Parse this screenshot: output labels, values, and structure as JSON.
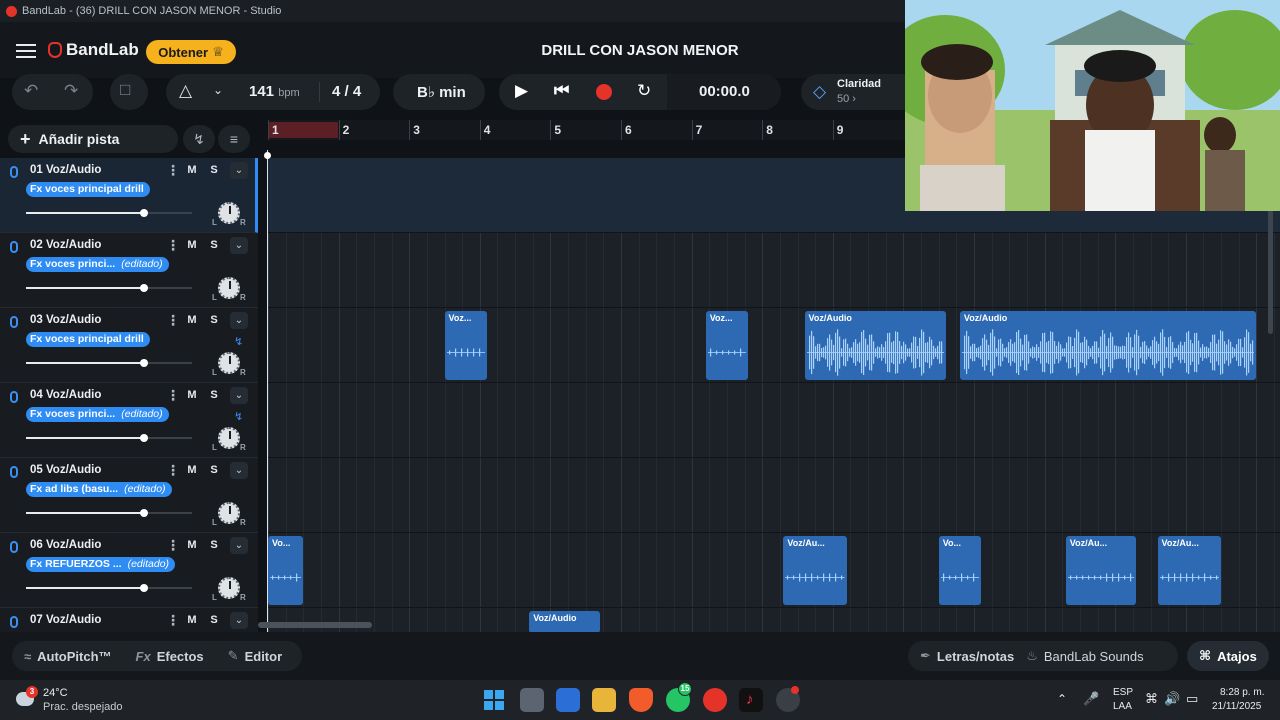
{
  "window": {
    "title": "BandLab - (36) DRILL CON JASON MENOR - Studio"
  },
  "header": {
    "brand": "BandLab",
    "get_button": "Obtener",
    "song_title": "DRILL CON JASON MENOR"
  },
  "toolbar": {
    "tempo_value": "141",
    "tempo_unit": "bpm",
    "time_signature": "4 / 4",
    "key": "B♭ min",
    "time_display": "00:00.0",
    "clarity_label": "Claridad",
    "clarity_value": "50"
  },
  "tracks_panel": {
    "add_track_label": "Añadir pista",
    "mute_label": "M",
    "solo_label": "S",
    "pan_left": "L",
    "pan_right": "R",
    "tracks": [
      {
        "name": "01  Voz/Audio",
        "fx": "Fx voces principal drill",
        "edited": "",
        "volume": 0.71,
        "selected": true,
        "automation": false
      },
      {
        "name": "02  Voz/Audio",
        "fx": "Fx voces princi...",
        "edited": "(editado)",
        "volume": 0.71,
        "selected": false,
        "automation": false
      },
      {
        "name": "03  Voz/Audio",
        "fx": "Fx voces principal drill",
        "edited": "",
        "volume": 0.71,
        "selected": false,
        "automation": true
      },
      {
        "name": "04  Voz/Audio",
        "fx": "Fx voces princi...",
        "edited": "(editado)",
        "volume": 0.71,
        "selected": false,
        "automation": true
      },
      {
        "name": "05  Voz/Audio",
        "fx": "Fx ad libs (basu...",
        "edited": "(editado)",
        "volume": 0.71,
        "selected": false,
        "automation": false
      },
      {
        "name": "06  Voz/Audio",
        "fx": "Fx REFUERZOS ...",
        "edited": "(editado)",
        "volume": 0.71,
        "selected": false,
        "automation": false
      },
      {
        "name": "07  Voz/Audio",
        "fx": "",
        "edited": "",
        "volume": 0.71,
        "selected": false,
        "automation": false
      }
    ]
  },
  "timeline": {
    "bars": [
      "1",
      "2",
      "3",
      "4",
      "5",
      "6",
      "7",
      "8",
      "9"
    ],
    "clips": [
      {
        "lane": 2,
        "label": "Voz...",
        "start_bar": 3.5,
        "end_bar": 4.1
      },
      {
        "lane": 2,
        "label": "Voz...",
        "start_bar": 7.2,
        "end_bar": 7.8
      },
      {
        "lane": 2,
        "label": "Voz/Audio",
        "start_bar": 8.6,
        "end_bar": 10.6
      },
      {
        "lane": 2,
        "label": "Voz/Audio",
        "start_bar": 10.8,
        "end_bar": 15.0
      },
      {
        "lane": 5,
        "label": "Vo...",
        "start_bar": 1.0,
        "end_bar": 1.5
      },
      {
        "lane": 5,
        "label": "Voz/Au...",
        "start_bar": 8.3,
        "end_bar": 9.2
      },
      {
        "lane": 5,
        "label": "Vo...",
        "start_bar": 10.5,
        "end_bar": 11.1
      },
      {
        "lane": 5,
        "label": "Voz/Au...",
        "start_bar": 12.3,
        "end_bar": 13.3
      },
      {
        "lane": 5,
        "label": "Voz/Au...",
        "start_bar": 13.6,
        "end_bar": 14.5
      },
      {
        "lane": 6,
        "label": "Voz/Audio",
        "start_bar": 4.7,
        "end_bar": 5.7
      }
    ]
  },
  "bottom_bar": {
    "autopitch": "AutoPitch™",
    "effects": "Efectos",
    "editor": "Editor",
    "lyrics": "Letras/notas",
    "sounds": "BandLab Sounds",
    "shortcuts": "Atajos"
  },
  "taskbar": {
    "weather_temp": "24°C",
    "weather_desc": "Prac. despejado",
    "weather_badge": "3",
    "whatsapp_badge": "15",
    "lang_top": "ESP",
    "lang_bottom": "LAA",
    "clock_time": "8:28 p. m.",
    "clock_date": "21/11/2025"
  },
  "colors": {
    "accent_blue": "#2f8cf2",
    "record_red": "#e5332a",
    "clip_blue": "#2e6ab4",
    "obtener_yellow": "#f5b21d"
  }
}
